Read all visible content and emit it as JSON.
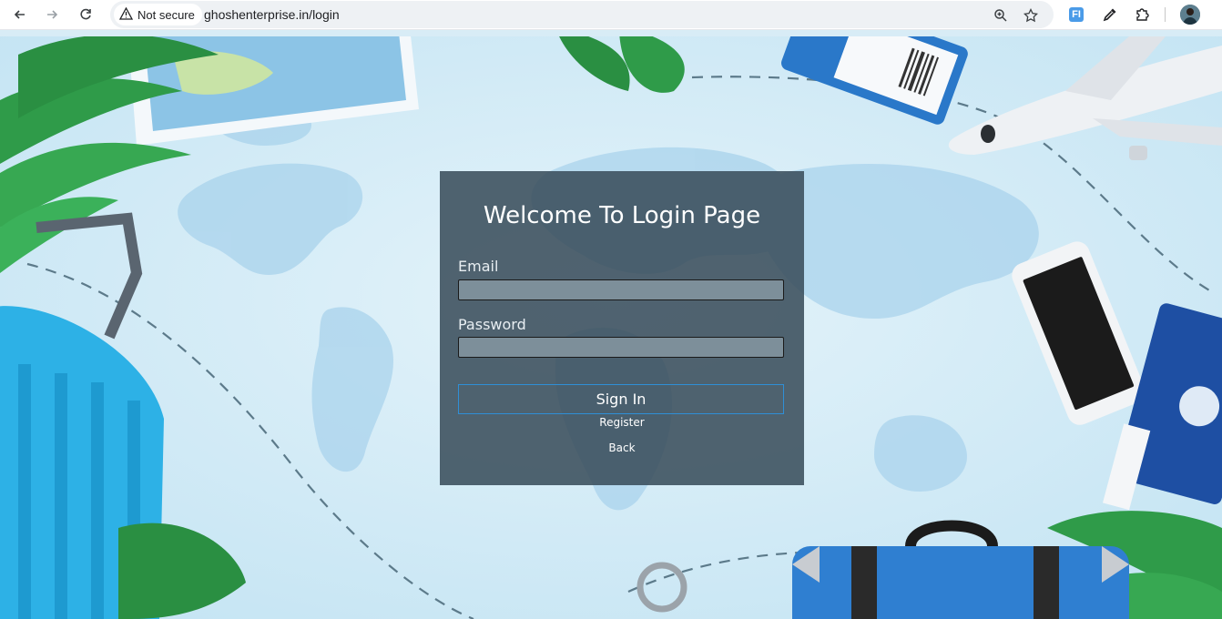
{
  "browser": {
    "security_label": "Not secure",
    "url": "ghoshenterprise.in/login",
    "extension_label": "FI"
  },
  "login": {
    "title": "Welcome To Login Page",
    "email_label": "Email",
    "email_value": "",
    "password_label": "Password",
    "password_value": "",
    "signin_label": "Sign In",
    "register_label": "Register",
    "back_label": "Back"
  },
  "colors": {
    "panel": "#374b58",
    "input": "#7d8f9a",
    "button_border": "#2f8fd6",
    "background_sky": "#cfe9f6"
  }
}
